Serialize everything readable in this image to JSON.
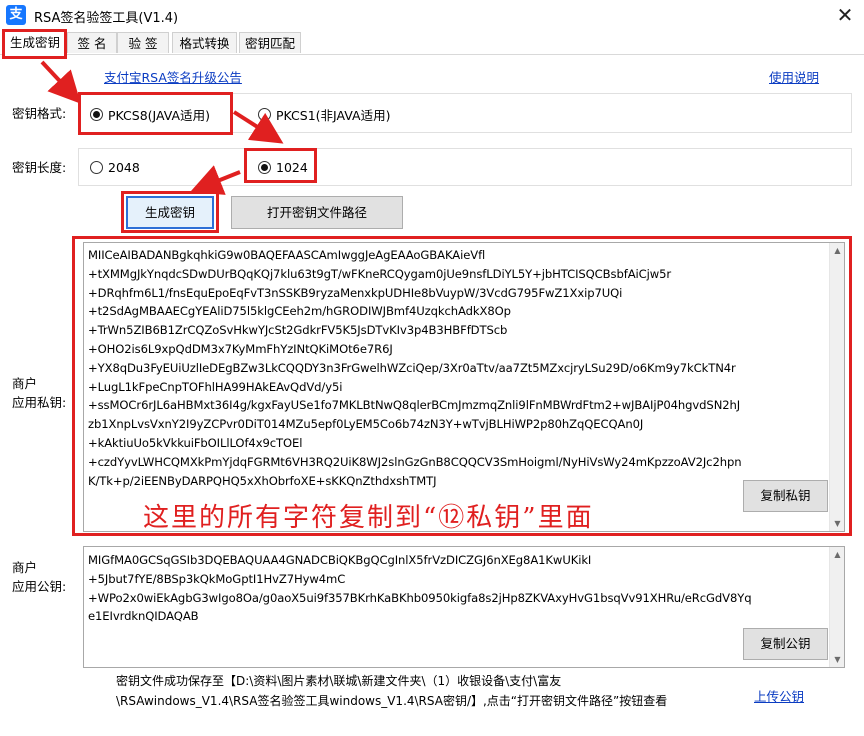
{
  "window": {
    "title": "RSA签名验签工具(V1.4)",
    "app_icon": "支",
    "close_glyph": "✕"
  },
  "tabs": [
    {
      "label": "生成密钥",
      "active": true
    },
    {
      "label": "签 名",
      "active": false
    },
    {
      "label": "验 签",
      "active": false
    },
    {
      "label": "格式转换",
      "active": false
    },
    {
      "label": "密钥匹配",
      "active": false
    }
  ],
  "links": {
    "announcement": "支付宝RSA签名升级公告",
    "help": "使用说明",
    "upload": "上传公钥"
  },
  "key_format": {
    "label": "密钥格式:",
    "options": [
      "PKCS8(JAVA适用)",
      "PKCS1(非JAVA适用)"
    ],
    "selected": "PKCS8(JAVA适用)"
  },
  "key_length": {
    "label": "密钥长度:",
    "options": [
      "2048",
      "1024"
    ],
    "selected": "1024"
  },
  "buttons": {
    "generate": "生成密钥",
    "open_path": "打开密钥文件路径",
    "copy_private": "复制私钥",
    "copy_public": "复制公钥"
  },
  "private_key": {
    "label_line1": "商户",
    "label_line2": "应用私钥:",
    "lines": [
      "MIICeAIBADANBgkqhkiG9w0BAQEFAASCAmIwggJeAgEAAoGBAKAieVfl",
      "+tXMMgJkYnqdcSDwDUrBQqKQj7klu63t9gT/wFKneRCQygam0jUe9nsfLDiYL5Y+jbHTCISQCBsbfAiCjw5r",
      "+DRqhfm6L1/fnsEquEpoEqFvT3nSSKB9ryzaMenxkpUDHIe8bVuypW/3VcdG795FwZ1Xxip7UQi",
      "+t2SdAgMBAAECgYEAliD75l5klgCEeh2m/hGRODIWJBmf4UzqkchAdkX8Op",
      "+TrWn5ZIB6B1ZrCQZoSvHkwYJcSt2GdkrFV5K5JsDTvKIv3p4B3HBFfDTScb",
      "+OHO2is6L9xpQdDM3x7KyMmFhYzINtQKiMOt6e7R6J",
      "+YX8qDu3FyEUiUzlIeDEgBZw3LkCQQDY3n3FrGwelhWZciQep/3Xr0aTtv/aa7Zt5MZxcjryLSu29D/o6Km9y7kCkTN4r",
      "+LugL1kFpeCnpTOFhlHA99HAkEAvQdVd/y5i",
      "+ssMOCr6rJL6aHBMxt36I4g/kgxFayUSe1fo7MKLBtNwQ8qlerBCmJmzmqZnli9lFnMBWrdFtm2+wJBAIjP04hgvdSN2hJ",
      "zb1XnpLvsVxnY2I9yZCPvr0DiT014MZu5epf0LyEM5Co6b74zN3Y+wTvjBLHiWP2p80hZqQECQAn0J",
      "+kAktiuUo5kVkkuiFbOILlLOf4x9cTOEl",
      "+czdYyvLWHCQMXkPmYjdqFGRMt6VH3RQ2UiK8WJ2slnGzGnB8CQQCV3SmHoigml/NyHiVsWy24mKpzzoAV2Jc2hpn",
      "K/Tk+p/2iEENByDARPQHQ5xXhObrfoXE+sKKQnZthdxshTMTJ"
    ]
  },
  "annotation": "这里的所有字符复制到“⑫私钥”里面",
  "public_key": {
    "label_line1": "商户",
    "label_line2": "应用公钥:",
    "lines": [
      "MIGfMA0GCSqGSIb3DQEBAQUAA4GNADCBiQKBgQCgInlX5frVzDICZGJ6nXEg8A1KwUKikI",
      "+5Jbut7fYE/8BSp3kQkMoGptI1HvZ7Hyw4mC",
      "+WPo2x0wiEkAgbG3wIgo8Oa/g0aoX5ui9f357BKrhKaBKhb0950kigfa8s2jHp8ZKVAxyHvG1bsqVv91XHRu/eRcGdV8Yq",
      "e1EIvrdknQIDAQAB"
    ]
  },
  "status": {
    "line1": "密钥文件成功保存至【D:\\资料\\图片素材\\联城\\新建文件夹\\（1）收银设备\\支付\\富友",
    "line2": "\\RSAwindows_V1.4\\RSA签名验签工具windows_V1.4\\RSA密钥/】,点击“打开密钥文件路径”按钮查看"
  },
  "colors": {
    "annotation_red": "#e02020",
    "link_blue": "#0b3cc2",
    "focus_blue": "#2c6fd6"
  }
}
